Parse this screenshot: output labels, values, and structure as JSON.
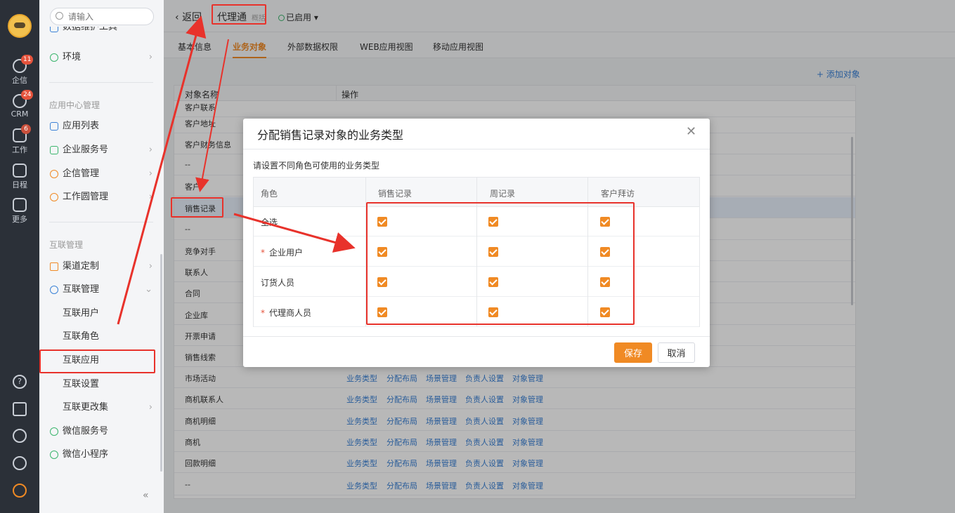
{
  "rail": {
    "items": [
      {
        "label": "企信",
        "badge": "11"
      },
      {
        "label": "CRM",
        "badge": "24"
      },
      {
        "label": "工作",
        "badge": "6"
      },
      {
        "label": "日程",
        "badge": ""
      },
      {
        "label": "更多",
        "badge": ""
      }
    ]
  },
  "nav": {
    "search_placeholder": "请输入",
    "top_items": [
      "数据维护工具",
      "环境"
    ],
    "section_app": "应用中心管理",
    "app_items": [
      "应用列表",
      "企业服务号",
      "企信管理",
      "工作圆管理"
    ],
    "section_link": "互联管理",
    "link_items": [
      "渠道定制",
      "互联管理"
    ],
    "sub_items": [
      "互联用户",
      "互联角色",
      "互联应用",
      "互联设置",
      "互联更改集"
    ],
    "bottom_items": [
      "微信服务号",
      "微信小程序"
    ]
  },
  "header": {
    "back": "返回",
    "title": "代理通",
    "tag": "概括",
    "status": "已启用"
  },
  "tabs": [
    "基本信息",
    "业务对象",
    "外部数据权限",
    "WEB应用视图",
    "移动应用视图"
  ],
  "add_object": "+ 添加对象",
  "table": {
    "col_name": "对象名称",
    "col_action": "操作",
    "rows": [
      "客户联系",
      "客户地址",
      "客户财务信息",
      "--",
      "客户",
      "销售记录",
      "--",
      "竞争对手",
      "联系人",
      "合同",
      "企业库",
      "开票申请",
      "销售线索",
      "市场活动",
      "商机联系人",
      "商机明细",
      "商机",
      "回款明细",
      "--"
    ],
    "actions": [
      "业务类型",
      "分配布局",
      "场景管理",
      "负责人设置",
      "对象管理"
    ]
  },
  "modal": {
    "title": "分配销售记录对象的业务类型",
    "desc": "请设置不同角色可使用的业务类型",
    "col_role": "角色",
    "cols": [
      "销售记录",
      "周记录",
      "客户拜访"
    ],
    "rows": [
      {
        "role": "全选",
        "required": false
      },
      {
        "role": "企业用户",
        "required": true
      },
      {
        "role": "订货人员",
        "required": false
      },
      {
        "role": "代理商人员",
        "required": true
      }
    ],
    "required_mark": "*",
    "save": "保存",
    "cancel": "取消"
  },
  "colors": {
    "accent": "#f08a24",
    "link": "#3b82d6",
    "annotation": "#e8322b"
  }
}
